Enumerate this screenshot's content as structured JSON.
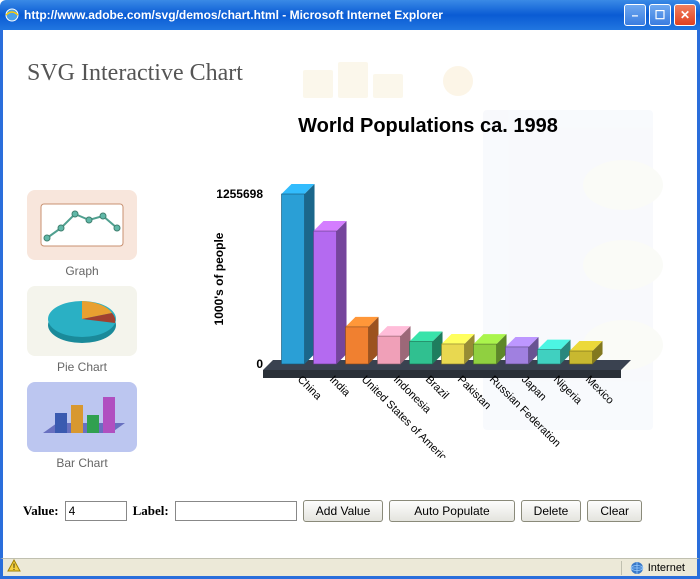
{
  "window": {
    "title": "http://www.adobe.com/svg/demos/chart.html - Microsoft Internet Explorer"
  },
  "page": {
    "heading": "SVG Interactive Chart"
  },
  "types": {
    "graph": "Graph",
    "pie": "Pie Chart",
    "bar": "Bar Chart"
  },
  "chart_data": {
    "type": "bar",
    "title": "World Populations ca. 1998",
    "ylabel": "1000's of people",
    "ymax_label": "1255698",
    "ymin_label": "0",
    "ylim": [
      0,
      1255698
    ],
    "categories": [
      "China",
      "India",
      "United States of America",
      "Indonesia",
      "Brazil",
      "Pakistan",
      "Russian Federation",
      "Japan",
      "Nigeria",
      "Mexico"
    ],
    "values": [
      1255698,
      982000,
      274000,
      206000,
      166000,
      148000,
      147000,
      126000,
      106000,
      96000
    ],
    "colors": [
      "#2a9fd6",
      "#b46af0",
      "#f08030",
      "#f0a0b8",
      "#30c090",
      "#e8d850",
      "#90d040",
      "#a080e0",
      "#40d0c0",
      "#c8b830"
    ]
  },
  "toolbar": {
    "value_label": "Value:",
    "value_input": "4",
    "label_label": "Label:",
    "label_input": "",
    "add": "Add Value",
    "auto": "Auto Populate",
    "delete": "Delete",
    "clear": "Clear"
  },
  "status": {
    "zone": "Internet"
  }
}
